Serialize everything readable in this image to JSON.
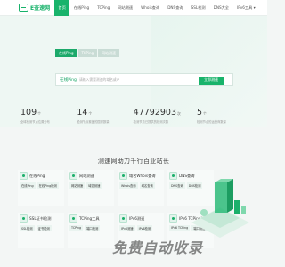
{
  "brand": {
    "logo_text": "E查速网"
  },
  "nav": {
    "items": [
      {
        "label": "首页",
        "active": true
      },
      {
        "label": "在线Ping",
        "active": false
      },
      {
        "label": "TCPing",
        "active": false
      },
      {
        "label": "网站测速",
        "active": false
      },
      {
        "label": "Whois查询",
        "active": false
      },
      {
        "label": "DNS查询",
        "active": false
      },
      {
        "label": "SSL检测",
        "active": false
      },
      {
        "label": "DNS大全",
        "active": false
      },
      {
        "label": "IPv6工具 ▾",
        "active": false
      }
    ]
  },
  "hero": {
    "tabs": [
      {
        "label": "在线Ping",
        "active": true
      },
      {
        "label": "TCPing",
        "active": false
      },
      {
        "label": "网站测速",
        "active": false
      }
    ],
    "search": {
      "prefix": "在线Ping",
      "placeholder": "请输入需要测速的域名或IP",
      "button": "立即测速"
    },
    "stats": [
      {
        "value": "109",
        "unit": "个",
        "desc": "全球检测节点位置分布"
      },
      {
        "value": "14",
        "unit": "个",
        "desc": "检测节点覆盖的国家数量"
      },
      {
        "value": "47792903",
        "unit": "次",
        "desc": "检测节点已提供的检测次数"
      },
      {
        "value": "5",
        "unit": "个",
        "desc": "检测节点的运营商数量"
      }
    ]
  },
  "section": {
    "title": "测速网助力千行百业站长",
    "cards": [
      {
        "title": "在线Ping",
        "links": [
          "在线Ping",
          "在线Ping检测"
        ]
      },
      {
        "title": "网站测速",
        "links": [
          "网站测速",
          "域名测速"
        ]
      },
      {
        "title": "域名Whois查询",
        "links": [
          "Whois查询",
          "域名查询"
        ]
      },
      {
        "title": "DNS查询",
        "links": [
          "DNS查询",
          "DNS检测"
        ]
      },
      {
        "title": "SSL证书检测",
        "links": [
          "SSL检测",
          "证书检测"
        ]
      },
      {
        "title": "TCPing工具",
        "links": [
          "TCPing",
          "端口检测"
        ]
      },
      {
        "title": "IPv6测速",
        "links": [
          "IPv6测速",
          "IPv6检测"
        ]
      },
      {
        "title": "IPv6 TCPing测速",
        "links": [
          "IPv6 TCPing",
          "端口测速"
        ]
      }
    ]
  },
  "watermark": "免费自动收录",
  "colors": {
    "accent": "#19b36b"
  }
}
